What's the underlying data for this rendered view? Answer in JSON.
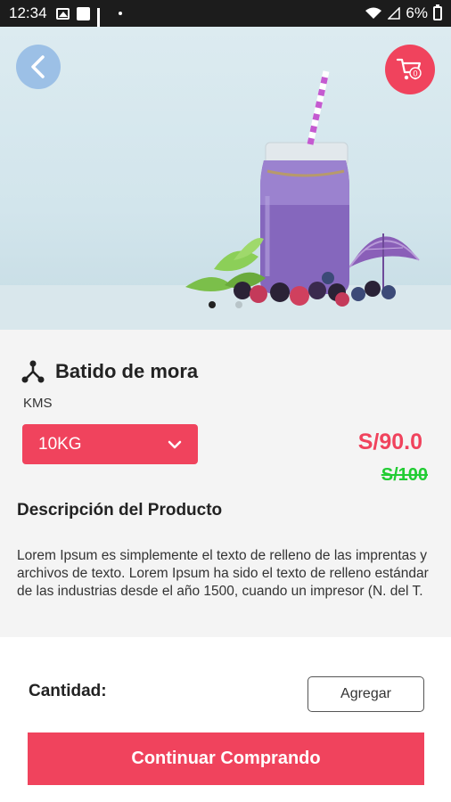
{
  "status_bar": {
    "time": "12:34",
    "battery": "6%"
  },
  "hero": {
    "carousel_dots": 2,
    "active_dot": 0,
    "cart_count": "0"
  },
  "product": {
    "name": "Batido de mora",
    "brand": "KMS",
    "weight_selected": "10KG",
    "price": "S/90.0",
    "old_price": "S/100",
    "description_title": "Descripción del Producto",
    "description": "Lorem Ipsum es simplemente el texto de relleno de las imprentas y archivos de texto. Lorem Ipsum ha sido el texto de relleno estándar de las industrias desde el año 1500, cuando un impresor (N. del T."
  },
  "actions": {
    "quantity_label": "Cantidad:",
    "add_label": "Agregar",
    "continue_label": "Continuar Comprando"
  },
  "colors": {
    "accent": "#f0435d",
    "old_price": "#22cc33",
    "back_button": "#9cc0e6"
  }
}
